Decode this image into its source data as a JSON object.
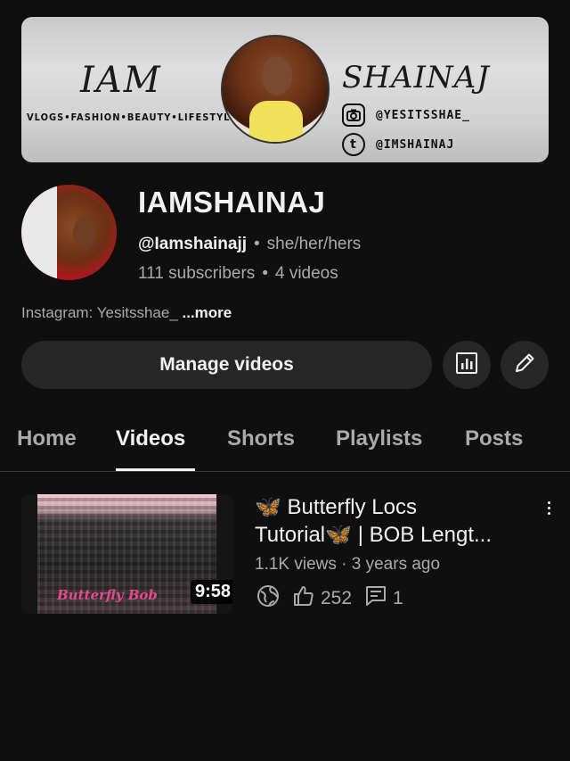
{
  "banner": {
    "title_left": "IAM",
    "title_right": "SHAINAJ",
    "tagline": "VLOGS•FASHION•BEAUTY•LIFESTYLE",
    "instagram_handle": "@YESITSSHAE_",
    "tumblr_handle": "@IMSHAINAJ"
  },
  "channel": {
    "name": "IAMSHAINAJ",
    "handle": "@Iamshainajj",
    "pronouns": "she/her/hers",
    "subscribers": "111 subscribers",
    "videos_count": "4 videos",
    "description": "Instagram: Yesitsshae_ ",
    "description_more": "...more"
  },
  "actions": {
    "manage_label": "Manage videos"
  },
  "tabs": [
    {
      "label": "Home",
      "active": false
    },
    {
      "label": "Videos",
      "active": true
    },
    {
      "label": "Shorts",
      "active": false
    },
    {
      "label": "Playlists",
      "active": false
    },
    {
      "label": "Posts",
      "active": false
    }
  ],
  "videos": [
    {
      "title_line1": "🦋 Butterfly Locs",
      "title_line2": "Tutorial🦋  | BOB Lengt...",
      "views": "1.1K views",
      "age": "3 years ago",
      "likes": "252",
      "comments": "1",
      "duration": "9:58",
      "thumb_caption": "Butterfly Bob"
    }
  ],
  "colors": {
    "background": "#0f0f0f",
    "button_bg": "#272727",
    "secondary_text": "#aaaaaa",
    "butterfly_blue": "#4aa8ff"
  }
}
